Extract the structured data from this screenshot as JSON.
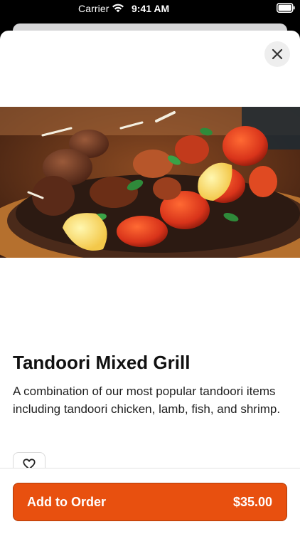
{
  "status_bar": {
    "carrier": "Carrier",
    "time": "9:41 AM",
    "wifi_icon": "wifi-icon",
    "battery_icon": "battery-icon"
  },
  "item": {
    "title": "Tandoori Mixed Grill",
    "description": "A combination of our most popular tandoori items including tandoori chicken, lamb, fish, and shrimp.",
    "image_subject": "tandoori mixed grill platter on a sizzling plate"
  },
  "actions": {
    "close_icon": "close-icon",
    "favorite_icon": "heart-outline-icon",
    "add_label": "Add to Order",
    "price": "$35.00"
  },
  "colors": {
    "accent": "#e8500f",
    "accent_border": "#b13d09",
    "text": "#111111",
    "background": "#ffffff"
  }
}
